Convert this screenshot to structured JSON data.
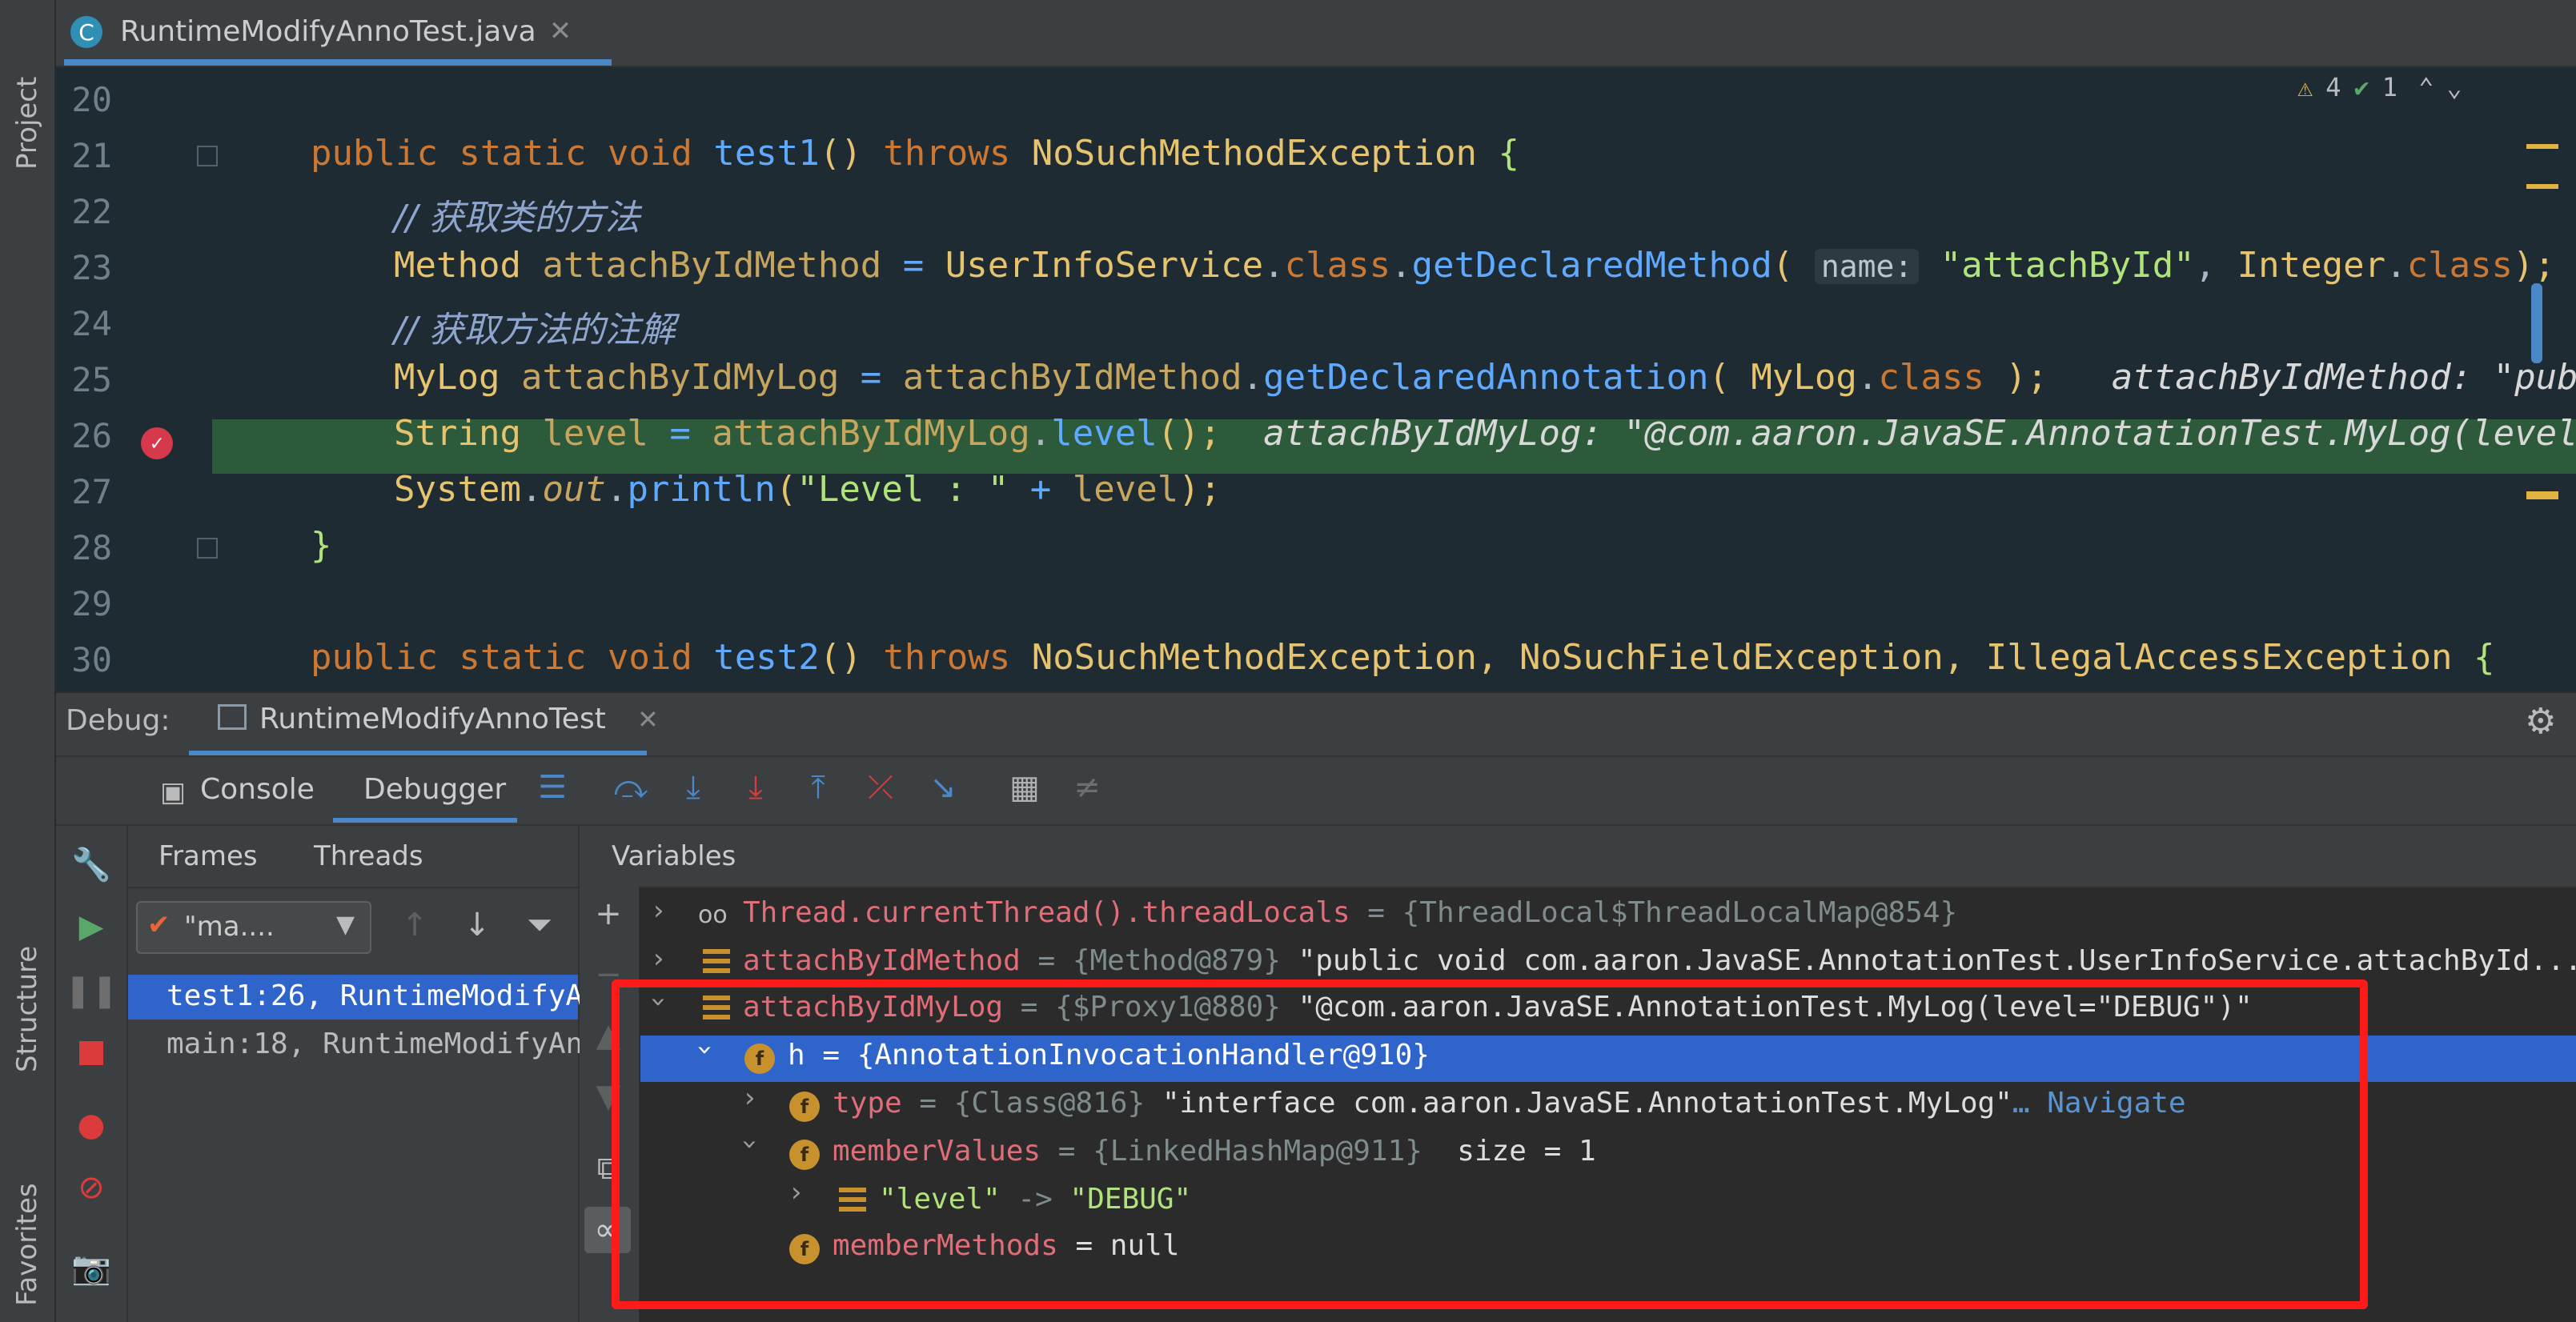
{
  "colors": {
    "accent": "#4a88c7",
    "selection": "#2f65ca",
    "highlight_box": "#ff1a1a",
    "exec_line": "#2d5a3b"
  },
  "left_strip": {
    "project": "Project",
    "structure": "Structure",
    "favorites": "Favorites"
  },
  "editor_tab": {
    "file": "RuntimeModifyAnnoTest.java",
    "icon": "java-class-icon"
  },
  "inspections": {
    "warnings": "4",
    "ok": "1"
  },
  "code": {
    "lines": [
      {
        "n": "20"
      },
      {
        "n": "21",
        "kw1": "public static void ",
        "fn": "test1",
        "p1": "() ",
        "kw2": "throws ",
        "tp": "NoSuchMethodException",
        "b": " {"
      },
      {
        "n": "22",
        "cm": "// 获取类的方法"
      },
      {
        "n": "23",
        "tp1": "Method ",
        "var": "attachByIdMethod",
        "eq": " = ",
        "tp2": "UserInfoService",
        "dot": ".",
        "kw": "class",
        "dot2": ".",
        "fn": "getDeclaredMethod",
        "po": "( ",
        "hint": "name:",
        "str": " \"attachById\"",
        "cm": ", ",
        "tp3": "Integer",
        "dot3": ".",
        "kw2": "class",
        "end": ");"
      },
      {
        "n": "24",
        "cm": "// 获取方法的注解"
      },
      {
        "n": "25",
        "tp1": "MyLog ",
        "var": "attachByIdMyLog",
        "eq": " = ",
        "var2": "attachByIdMethod",
        "dot": ".",
        "fn": "getDeclaredAnnotation",
        "po": "( ",
        "tp2": "MyLog",
        "dot2": ".",
        "kw": "class",
        "end": " );",
        "inline": "attachByIdMethod: \"publ"
      },
      {
        "n": "26",
        "tp1": "String ",
        "var": "level",
        "eq": " = ",
        "var2": "attachByIdMyLog",
        "dot": ".",
        "fn": "level",
        "end": "();",
        "inline": "attachByIdMyLog: \"@com.aaron.JavaSE.AnnotationTest.MyLog(level="
      },
      {
        "n": "27",
        "tp1": "System",
        "dot": ".",
        "it": "out",
        "dot2": ".",
        "fn": "println",
        "po": "(",
        "str": "\"Level : \"",
        "op": " + ",
        "var": "level",
        "end": ");"
      },
      {
        "n": "28",
        "b": "}"
      },
      {
        "n": "29"
      },
      {
        "n": "30",
        "kw1": "public static void ",
        "fn": "test2",
        "p1": "() ",
        "kw2": "throws ",
        "tp": "NoSuchMethodException, NoSuchFieldException, IllegalAccessException",
        "b": " {"
      }
    ]
  },
  "debug": {
    "label": "Debug:",
    "config": "RuntimeModifyAnnoTest",
    "tabs": {
      "console": "Console",
      "debugger": "Debugger"
    },
    "frames_tab": "Frames",
    "threads_tab": "Threads",
    "thread_combo": "\"ma.... ",
    "frames": [
      "test1:26, RuntimeModifyA",
      "main:18, RuntimeModifyAn"
    ],
    "variables_title": "Variables"
  },
  "variables": [
    {
      "name": "Thread.currentThread().threadLocals",
      "eq": " = ",
      "meta": "{ThreadLocal$ThreadLocalMap@854}",
      "val": ""
    },
    {
      "name": "attachByIdMethod",
      "eq": " = ",
      "meta": "{Method@879}",
      "val": " \"public void com.aaron.JavaSE.AnnotationTest.UserInfoService.attachById...",
      "more": " V"
    },
    {
      "name": "attachByIdMyLog",
      "eq": " = ",
      "meta": "{$Proxy1@880}",
      "val": " \"@com.aaron.JavaSE.AnnotationTest.MyLog(level=\"DEBUG\")\""
    },
    {
      "text": "h = {AnnotationInvocationHandler@910}"
    },
    {
      "name": "type",
      "eq": " = ",
      "meta": "{Class@816}",
      "val": " \"interface com.aaron.JavaSE.AnnotationTest.MyLog\"",
      "link": "… Navigate"
    },
    {
      "name": "memberValues",
      "eq": " = ",
      "meta": "{LinkedHashMap@911}",
      "val": "  size = 1"
    },
    {
      "key": "\"level\"",
      "arrow": " -> ",
      "val": "\"DEBUG\""
    },
    {
      "name": "memberMethods",
      "eq": " = ",
      "val": "null"
    }
  ]
}
